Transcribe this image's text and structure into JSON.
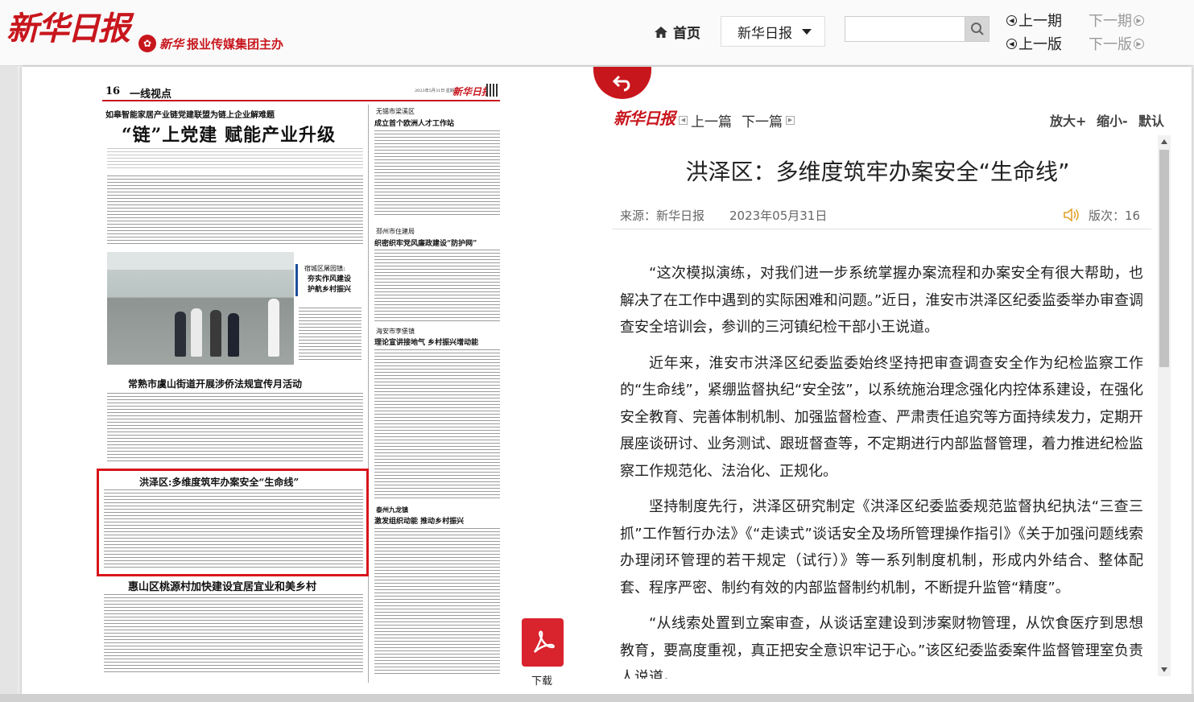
{
  "header": {
    "logo": "新华日报",
    "sublogo": "报业传媒集团主办",
    "sublogo_mark": "新华",
    "home_label": "首页",
    "paper_selected": "新华日报",
    "search_placeholder": "",
    "prev_issue": "上一期",
    "next_issue": "下一期",
    "prev_page": "上一版",
    "next_page": "下一版"
  },
  "newspaper": {
    "page_no": "16",
    "section": "一线视点",
    "date_line": "2023年5月31日 星期三",
    "masthead": "新华日报",
    "kicker": "如皋智能家居产业链党建联盟为链上企业解难题",
    "headline": "“链”上党建 赋能产业升级",
    "right_col_1_region": "无锡市梁溪区",
    "right_col_1_title": "成立首个欧洲人才工作站",
    "right_col_2_region": "邳州市住建局",
    "right_col_2_title": "织密织牢党风廉政建设“防护网”",
    "right_col_3_region": "海安市李堡镇",
    "right_col_3_title": "理论宣讲接地气 乡村振兴增动能",
    "right_col_4_region": "泰州九龙镇",
    "right_col_4_title": "激发组织动能 推动乡村振兴",
    "photo_region": "宿城区屠园镇:",
    "photo_title_1": "夯实作风建设",
    "photo_title_2": "护航乡村振兴",
    "story2_title": "常熟市虞山街道开展涉侨法规宣传月活动",
    "story3_title": "洪泽区:多维度筑牢办案安全“生命线”",
    "story4_title": "惠山区桃源村加快建设宜居宜业和美乡村"
  },
  "download": {
    "label": "下载"
  },
  "article": {
    "logo": "新华日报",
    "prev_label": "上一篇",
    "next_label": "下一篇",
    "zoom_in": "放大+",
    "zoom_out": "缩小-",
    "zoom_default": "默认",
    "title": "洪泽区：多维度筑牢办案安全“生命线”",
    "source": "来源：新华日报",
    "date": "2023年05月31日",
    "page": "版次：16",
    "paragraphs": [
      "“这次模拟演练，对我们进一步系统掌握办案流程和办案安全有很大帮助，也解决了在工作中遇到的实际困难和问题。”近日，淮安市洪泽区纪委监委举办审查调查安全培训会，参训的三河镇纪检干部小王说道。",
      "近年来，淮安市洪泽区纪委监委始终坚持把审查调查安全作为纪检监察工作的“生命线”，紧绷监督执纪“安全弦”，以系统施治理念强化内控体系建设，在强化安全教育、完善体制机制、加强监督检查、严肃责任追究等方面持续发力，定期开展座谈研讨、业务测试、跟班督查等，不定期进行内部监督管理，着力推进纪检监察工作规范化、法治化、正规化。",
      "坚持制度先行，洪泽区研究制定《洪泽区纪委监委规范监督执纪执法“三查三抓”工作暂行办法》《“走读式”谈话安全及场所管理操作指引》《关于加强问题线索办理闭环管理的若干规定（试行）》等一系列制度机制，形成内外结合、整体配套、程序严密、制约有效的内部监督制约机制，不断提升监管“精度”。",
      "“从线索处置到立案审查，从谈话室建设到涉案财物管理，从饮食医疗到思想教育，要高度重视，真正把安全意识牢记于心。”该区纪委监委案件监督管理室负责人说道。"
    ]
  },
  "colors": {
    "brand_red": "#c8161d",
    "highlight_red": "#d7151b"
  },
  "icons": [
    "home-icon",
    "caret-down-icon",
    "search-icon",
    "prev-circle-icon",
    "next-circle-icon",
    "back-arrow-icon",
    "pdf-icon",
    "speaker-icon"
  ]
}
